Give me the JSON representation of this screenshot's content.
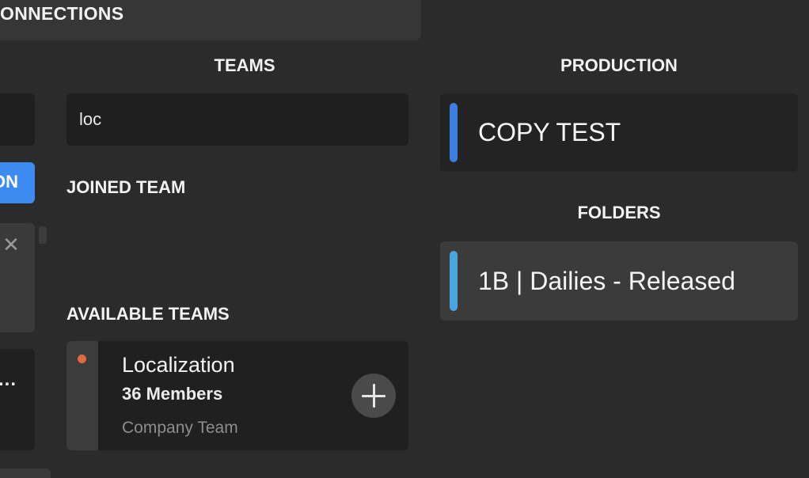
{
  "connections": {
    "label": "ONNECTIONS"
  },
  "left_column": {
    "button_label_fragment": "ON",
    "close_icon": "close-icon",
    "ellipsis": "..."
  },
  "teams": {
    "title": "TEAMS",
    "search_value": "loc",
    "joined_title": "JOINED TEAM",
    "available_title": "AVAILABLE TEAMS",
    "available": [
      {
        "name": "Localization",
        "members": "36 Members",
        "type": "Company Team",
        "dot_color": "#df6a3f",
        "action_icon": "plus-icon"
      }
    ]
  },
  "production": {
    "title": "PRODUCTION",
    "selected": "COPY TEST",
    "accent": "#3b7ee0"
  },
  "folders": {
    "title": "FOLDERS",
    "items": [
      {
        "name": "1B | Dailies - Released",
        "accent": "#4ba4e0"
      }
    ]
  }
}
